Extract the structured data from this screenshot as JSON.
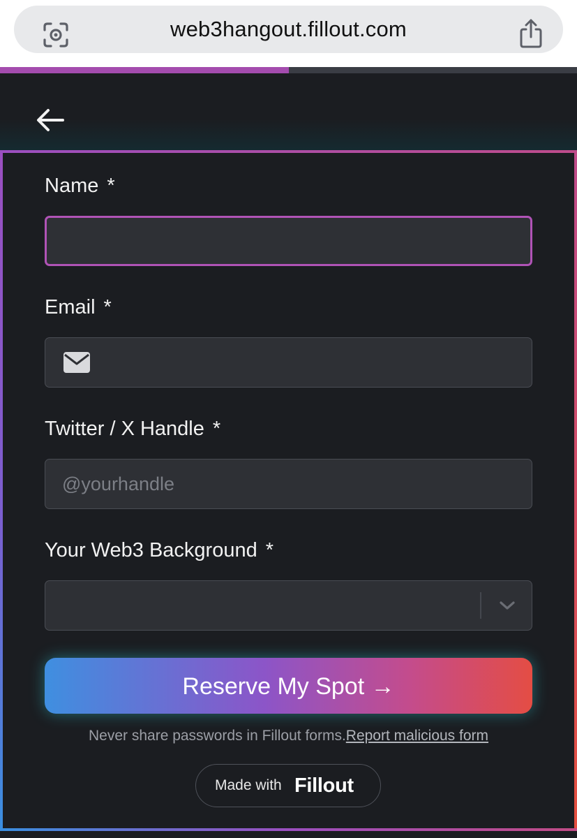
{
  "browser": {
    "url": "web3hangout.fillout.com",
    "lens_icon": "camera-scan-icon",
    "share_icon": "share-icon"
  },
  "progress": {
    "fraction": 0.5,
    "fill_color": "#a44cae",
    "track_color": "#3a3d44"
  },
  "header": {
    "back_icon": "arrow-left-icon"
  },
  "form": {
    "name": {
      "label": "Name",
      "required_mark": "*",
      "value": "",
      "placeholder": ""
    },
    "email": {
      "label": "Email",
      "required_mark": "*",
      "value": "",
      "placeholder": "",
      "icon": "envelope-icon"
    },
    "twitter": {
      "label": "Twitter / X Handle",
      "required_mark": "*",
      "value": "",
      "placeholder": "@yourhandle"
    },
    "background": {
      "label": "Your Web3 Background",
      "required_mark": "*",
      "selected": "",
      "icon": "chevron-down-icon"
    },
    "submit_label": "Reserve My Spot →"
  },
  "footer": {
    "disclaimer": "Never share passwords in Fillout forms.",
    "report_link": "Report malicious form",
    "made_with": "Made with",
    "brand": "Fillout"
  },
  "colors": {
    "page_bg": "#1b1d21",
    "field_bg": "#2e3035",
    "focus_border": "#b053b6",
    "gradient_start": "#3f8fe0",
    "gradient_end": "#e44d44"
  }
}
